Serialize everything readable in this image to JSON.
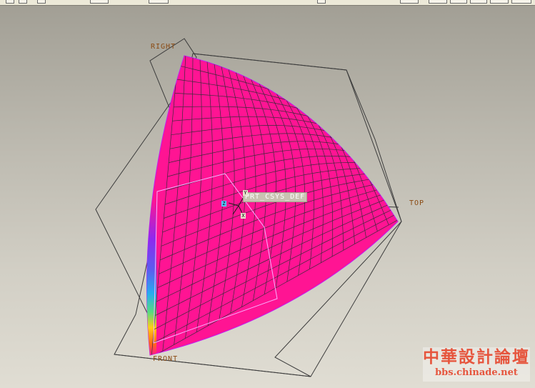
{
  "datum_planes": {
    "right": "RIGHT",
    "top": "TOP",
    "front": "FRONT"
  },
  "coordinate_system": {
    "name": "PRT_CSYS_DEF",
    "x_axis": "X",
    "y_axis": "Y",
    "z_axis": "Z"
  },
  "watermark": {
    "title": "中華設計論壇",
    "url": "bbs.chinade.net"
  },
  "colors": {
    "surface": "#ff1493",
    "mesh": "#3a2a3a",
    "datum_outline": "#3c3c3c",
    "label": "#8a4a12",
    "watermark": "#e6553d"
  }
}
